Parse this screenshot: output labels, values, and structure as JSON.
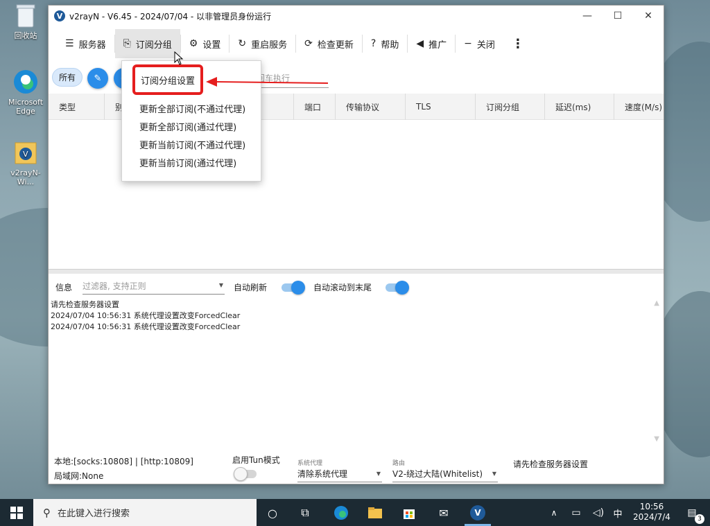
{
  "desktop": {
    "icons": [
      {
        "label": "回收站"
      },
      {
        "label": "Microsoft Edge"
      },
      {
        "label": "v2rayN-Wi..."
      }
    ]
  },
  "window": {
    "title": "v2rayN - V6.45 - 2024/07/04 - 以非管理员身份运行",
    "controls": {
      "minimize": "—",
      "maximize": "☐",
      "close": "✕"
    }
  },
  "toolbar": {
    "items": [
      {
        "label": "服务器",
        "icon": "server-icon"
      },
      {
        "label": "订阅分组",
        "icon": "subscription-icon"
      },
      {
        "label": "设置",
        "icon": "gear-icon"
      },
      {
        "label": "重启服务",
        "icon": "restart-icon"
      },
      {
        "label": "检查更新",
        "icon": "update-icon"
      },
      {
        "label": "帮助",
        "icon": "help-icon"
      },
      {
        "label": "推广",
        "icon": "speaker-icon"
      },
      {
        "label": "关闭",
        "icon": "minus-icon"
      }
    ]
  },
  "filter": {
    "chip": "所有",
    "search_fragment": "回车执行"
  },
  "grid": {
    "columns": [
      "类型",
      "别",
      "",
      "端口",
      "传输协议",
      "TLS",
      "订阅分组",
      "延迟(ms)",
      "速度(M/s)"
    ]
  },
  "menu": {
    "items": [
      "订阅分组设置",
      "更新全部订阅(不通过代理)",
      "更新全部订阅(通过代理)",
      "更新当前订阅(不通过代理)",
      "更新当前订阅(通过代理)"
    ]
  },
  "log": {
    "label": "信息",
    "filter_placeholder": "过滤器, 支持正则",
    "auto_refresh": "自动刷新",
    "auto_scroll": "自动滚动到末尾",
    "lines": [
      "请先检查服务器设置",
      "2024/07/04 10:56:31 系统代理设置改变ForcedClear",
      "2024/07/04 10:56:31 系统代理设置改变ForcedClear"
    ]
  },
  "status": {
    "local": "本地:[socks:10808] | [http:10809]",
    "lan": "局域网:None",
    "tun_label": "启用Tun模式",
    "sysproxy_label": "系统代理",
    "sysproxy_value": "清除系统代理",
    "routing_label": "路由",
    "routing_value": "V2-绕过大陆(Whitelist)",
    "message": "请先检查服务器设置"
  },
  "taskbar": {
    "search_placeholder": "在此键入进行搜索",
    "ime": "中",
    "time": "10:56",
    "date": "2024/7/4",
    "notifications": "3"
  },
  "colors": {
    "accent": "#2b8de9",
    "highlight": "#e51e1e"
  }
}
